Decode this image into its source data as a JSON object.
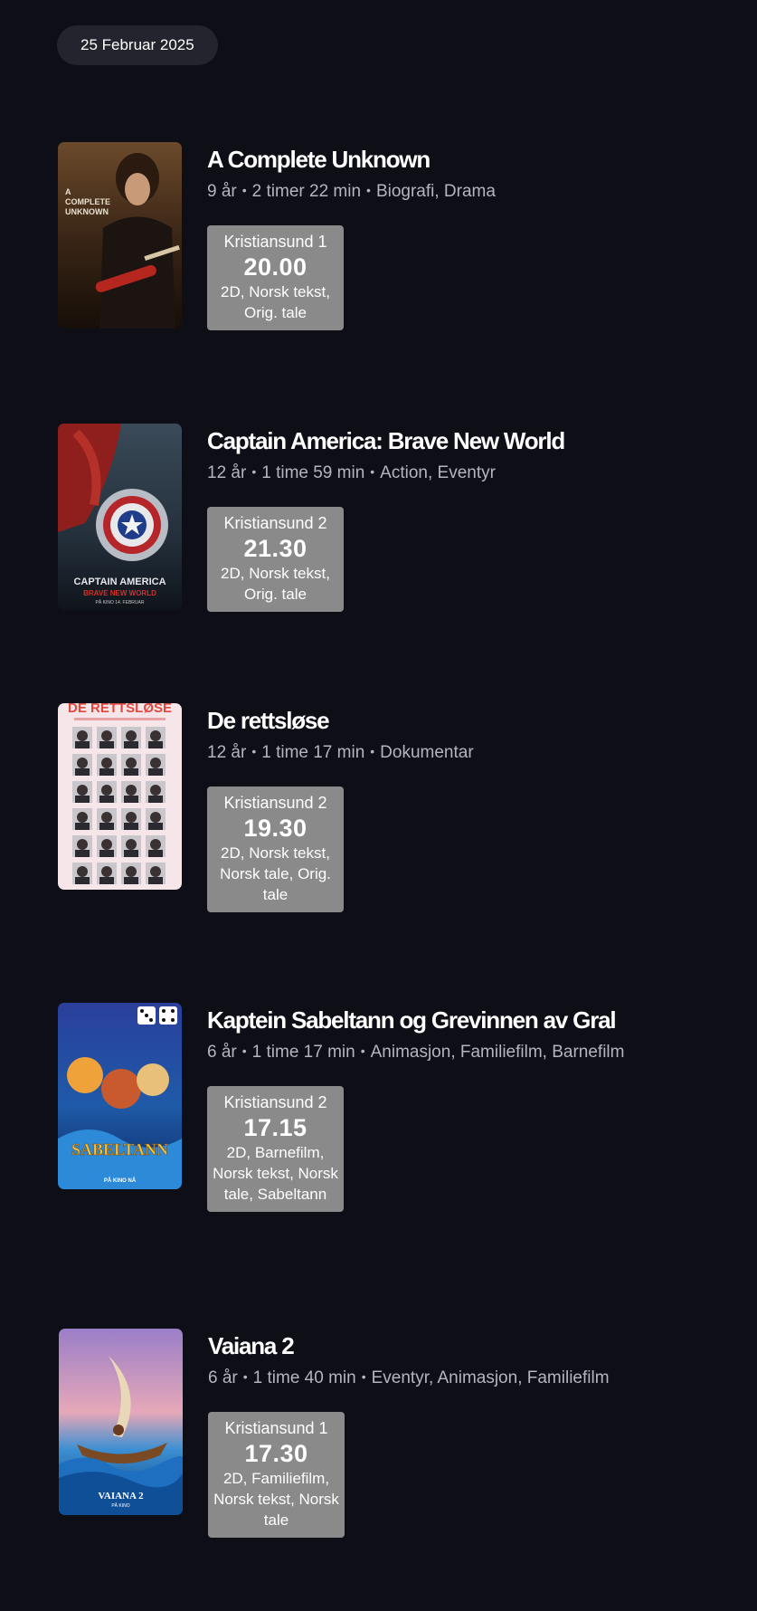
{
  "date_label": "25 Februar 2025",
  "movies": [
    {
      "title": "A Complete Unknown",
      "age": "9 år",
      "duration": "2 timer 22 min",
      "genres": "Biografi, Drama",
      "show": {
        "venue": "Kristiansund 1",
        "time": "20.00",
        "tags": "2D, Norsk tekst, Orig. tale"
      },
      "poster_lines": [
        "A",
        "COMPLETE",
        "UNKNOWN"
      ]
    },
    {
      "title": "Captain America: Brave New World",
      "age": "12 år",
      "duration": "1 time 59 min",
      "genres": "Action, Eventyr",
      "show": {
        "venue": "Kristiansund 2",
        "time": "21.30",
        "tags": "2D, Norsk tekst, Orig. tale"
      },
      "poster_lines": [
        "CAPTAIN AMERICA",
        "BRAVE NEW WORLD",
        "PÅ KINO 14. FEBRUAR"
      ]
    },
    {
      "title": "De rettsløse",
      "age": "12 år",
      "duration": "1 time 17 min",
      "genres": "Dokumentar",
      "show": {
        "venue": "Kristiansund 2",
        "time": "19.30",
        "tags": "2D, Norsk tekst, Norsk tale, Orig. tale"
      },
      "poster_lines": [
        "DE RETTSLØSE"
      ]
    },
    {
      "title": "Kaptein Sabeltann og Grevinnen av Gral",
      "age": "6 år",
      "duration": "1 time 17 min",
      "genres": "Animasjon, Familiefilm, Barnefilm",
      "show": {
        "venue": "Kristiansund 2",
        "time": "17.15",
        "tags": "2D, Barnefilm, Norsk tekst, Norsk tale, Sabeltann"
      },
      "poster_lines": [
        "SABELTANN",
        "PÅ KINO NÅ"
      ]
    },
    {
      "title": "Vaiana 2",
      "age": "6 år",
      "duration": "1 time 40 min",
      "genres": "Eventyr, Animasjon, Familiefilm",
      "show": {
        "venue": "Kristiansund 1",
        "time": "17.30",
        "tags": "2D, Familiefilm, Norsk tekst, Norsk tale"
      },
      "poster_lines": [
        "VAIANA 2",
        "PÅ KINO"
      ]
    }
  ]
}
